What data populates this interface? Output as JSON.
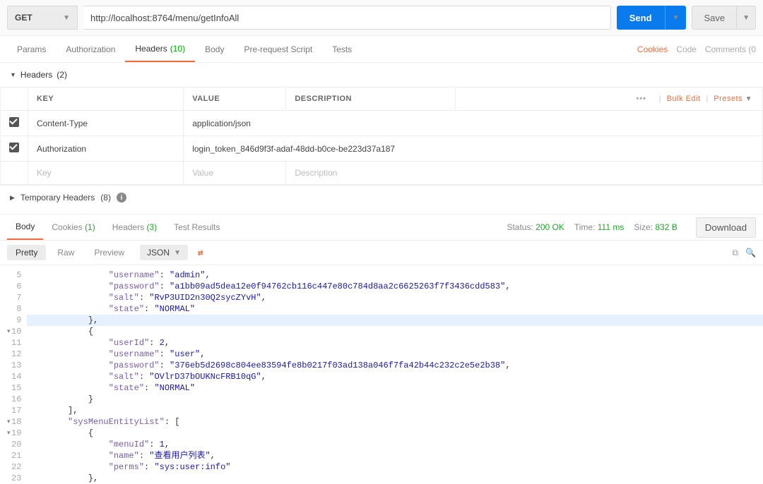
{
  "request": {
    "method": "GET",
    "url": "http://localhost:8764/menu/getInfoAll",
    "send_label": "Send",
    "save_label": "Save"
  },
  "req_tabs": {
    "params": "Params",
    "authorization": "Authorization",
    "headers": "Headers",
    "headers_count": "(10)",
    "body": "Body",
    "prerequest": "Pre-request Script",
    "tests": "Tests"
  },
  "top_links": {
    "cookies": "Cookies",
    "code": "Code",
    "comments": "Comments (0"
  },
  "headers_section": {
    "title": "Headers",
    "count": "(2)",
    "columns": {
      "key": "KEY",
      "value": "VALUE",
      "description": "DESCRIPTION"
    },
    "actions": {
      "bulk": "Bulk Edit",
      "presets": "Presets"
    },
    "rows": [
      {
        "key": "Content-Type",
        "value": "application/json"
      },
      {
        "key": "Authorization",
        "value": "login_token_846d9f3f-adaf-48dd-b0ce-be223d37a187"
      }
    ],
    "placeholder": {
      "key": "Key",
      "value": "Value",
      "description": "Description"
    }
  },
  "temp_headers": {
    "title": "Temporary Headers",
    "count": "(8)"
  },
  "resp_tabs": {
    "body": "Body",
    "cookies": "Cookies",
    "cookies_count": "(1)",
    "headers": "Headers",
    "headers_count": "(3)",
    "test_results": "Test Results"
  },
  "resp_status": {
    "status_lbl": "Status:",
    "status_val": "200 OK",
    "time_lbl": "Time:",
    "time_val": "111 ms",
    "size_lbl": "Size:",
    "size_val": "832 B",
    "download": "Download"
  },
  "body_toolbar": {
    "pretty": "Pretty",
    "raw": "Raw",
    "preview": "Preview",
    "format": "JSON"
  },
  "code_lines": [
    {
      "n": "5",
      "indent": 16,
      "frags": [
        {
          "t": "k",
          "v": "\"username\""
        },
        {
          "t": "p",
          "v": ": "
        },
        {
          "t": "s",
          "v": "\"admin\""
        },
        {
          "t": "p",
          "v": ","
        }
      ]
    },
    {
      "n": "6",
      "indent": 16,
      "frags": [
        {
          "t": "k",
          "v": "\"password\""
        },
        {
          "t": "p",
          "v": ": "
        },
        {
          "t": "s",
          "v": "\"a1bb09ad5dea12e0f94762cb116c447e80c784d8aa2c6625263f7f3436cdd583\""
        },
        {
          "t": "p",
          "v": ","
        }
      ]
    },
    {
      "n": "7",
      "indent": 16,
      "frags": [
        {
          "t": "k",
          "v": "\"salt\""
        },
        {
          "t": "p",
          "v": ": "
        },
        {
          "t": "s",
          "v": "\"RvP3UID2n30Q2sycZYvH\""
        },
        {
          "t": "p",
          "v": ","
        }
      ]
    },
    {
      "n": "8",
      "indent": 16,
      "frags": [
        {
          "t": "k",
          "v": "\"state\""
        },
        {
          "t": "p",
          "v": ": "
        },
        {
          "t": "s",
          "v": "\"NORMAL\""
        }
      ]
    },
    {
      "n": "9",
      "indent": 12,
      "hl": true,
      "frags": [
        {
          "t": "p",
          "v": "},"
        }
      ]
    },
    {
      "n": "10",
      "indent": 12,
      "fold": true,
      "frags": [
        {
          "t": "p",
          "v": "{"
        }
      ]
    },
    {
      "n": "11",
      "indent": 16,
      "frags": [
        {
          "t": "k",
          "v": "\"userId\""
        },
        {
          "t": "p",
          "v": ": "
        },
        {
          "t": "n",
          "v": "2"
        },
        {
          "t": "p",
          "v": ","
        }
      ]
    },
    {
      "n": "12",
      "indent": 16,
      "frags": [
        {
          "t": "k",
          "v": "\"username\""
        },
        {
          "t": "p",
          "v": ": "
        },
        {
          "t": "s",
          "v": "\"user\""
        },
        {
          "t": "p",
          "v": ","
        }
      ]
    },
    {
      "n": "13",
      "indent": 16,
      "frags": [
        {
          "t": "k",
          "v": "\"password\""
        },
        {
          "t": "p",
          "v": ": "
        },
        {
          "t": "s",
          "v": "\"376eb5d2698c804ee83594fe8b0217f03ad138a046f7fa42b44c232c2e5e2b38\""
        },
        {
          "t": "p",
          "v": ","
        }
      ]
    },
    {
      "n": "14",
      "indent": 16,
      "frags": [
        {
          "t": "k",
          "v": "\"salt\""
        },
        {
          "t": "p",
          "v": ": "
        },
        {
          "t": "s",
          "v": "\"OVlrD37bOUKNcFRB10qG\""
        },
        {
          "t": "p",
          "v": ","
        }
      ]
    },
    {
      "n": "15",
      "indent": 16,
      "frags": [
        {
          "t": "k",
          "v": "\"state\""
        },
        {
          "t": "p",
          "v": ": "
        },
        {
          "t": "s",
          "v": "\"NORMAL\""
        }
      ]
    },
    {
      "n": "16",
      "indent": 12,
      "frags": [
        {
          "t": "p",
          "v": "}"
        }
      ]
    },
    {
      "n": "17",
      "indent": 8,
      "frags": [
        {
          "t": "p",
          "v": "],"
        }
      ]
    },
    {
      "n": "18",
      "indent": 8,
      "fold": true,
      "frags": [
        {
          "t": "k",
          "v": "\"sysMenuEntityList\""
        },
        {
          "t": "p",
          "v": ": ["
        }
      ]
    },
    {
      "n": "19",
      "indent": 12,
      "fold": true,
      "frags": [
        {
          "t": "p",
          "v": "{"
        }
      ]
    },
    {
      "n": "20",
      "indent": 16,
      "frags": [
        {
          "t": "k",
          "v": "\"menuId\""
        },
        {
          "t": "p",
          "v": ": "
        },
        {
          "t": "n",
          "v": "1"
        },
        {
          "t": "p",
          "v": ","
        }
      ]
    },
    {
      "n": "21",
      "indent": 16,
      "frags": [
        {
          "t": "k",
          "v": "\"name\""
        },
        {
          "t": "p",
          "v": ": "
        },
        {
          "t": "s",
          "v": "\"查看用户列表\""
        },
        {
          "t": "p",
          "v": ","
        }
      ]
    },
    {
      "n": "22",
      "indent": 16,
      "frags": [
        {
          "t": "k",
          "v": "\"perms\""
        },
        {
          "t": "p",
          "v": ": "
        },
        {
          "t": "s",
          "v": "\"sys:user:info\""
        }
      ]
    },
    {
      "n": "23",
      "indent": 12,
      "frags": [
        {
          "t": "p",
          "v": "},"
        }
      ]
    }
  ]
}
